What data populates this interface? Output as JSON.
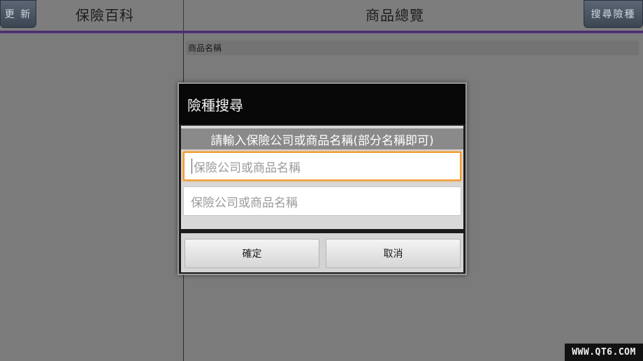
{
  "header": {
    "update_button": "更 新",
    "left_title": "保險百科",
    "main_title": "商品總覽",
    "search_button": "搜尋險種"
  },
  "list": {
    "column_header": "商品名稱"
  },
  "dialog": {
    "title": "險種搜尋",
    "prompt": "請輸入保險公司或商品名稱(部分名稱即可)",
    "input1_placeholder": "保險公司或商品名稱",
    "input2_placeholder": "保險公司或商品名稱",
    "ok_label": "確定",
    "cancel_label": "取消"
  },
  "watermark": "WWW.QT6.COM",
  "colors": {
    "accent_bar": "#4a2c6e",
    "focus_border": "#f39a2c"
  }
}
